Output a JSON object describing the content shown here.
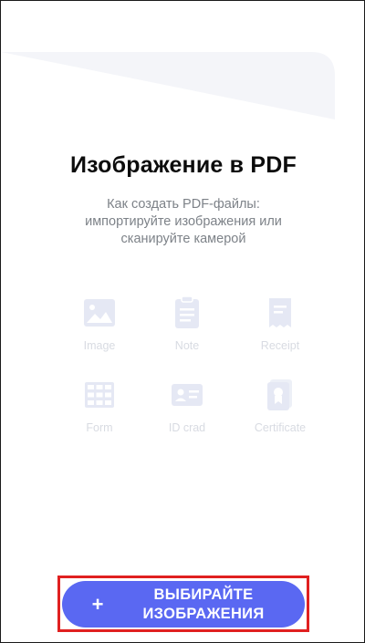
{
  "header": {
    "title": "Изображение в PDF",
    "subtitle_lines": [
      "Как создать PDF-файлы:",
      "импортируйте изображения или",
      "сканируйте камерой"
    ]
  },
  "doc_types": [
    {
      "label": "Image",
      "icon": "image-icon"
    },
    {
      "label": "Note",
      "icon": "note-icon"
    },
    {
      "label": "Receipt",
      "icon": "receipt-icon"
    },
    {
      "label": "Form",
      "icon": "form-icon"
    },
    {
      "label": "ID crad",
      "icon": "id-card-icon"
    },
    {
      "label": "Certificate",
      "icon": "certificate-icon"
    }
  ],
  "cta": {
    "icon": "plus-icon",
    "plus": "+",
    "label_lines": [
      "ВЫБИРАЙТЕ",
      "ИЗОБРАЖЕНИЯ"
    ]
  },
  "colors": {
    "accent": "#5a68f2",
    "icon_tint": "#e5e8f4",
    "label_tint": "#d8dbe2",
    "highlight": "#e02020",
    "title": "#0c0c0c",
    "subtitle": "#7d8288"
  }
}
